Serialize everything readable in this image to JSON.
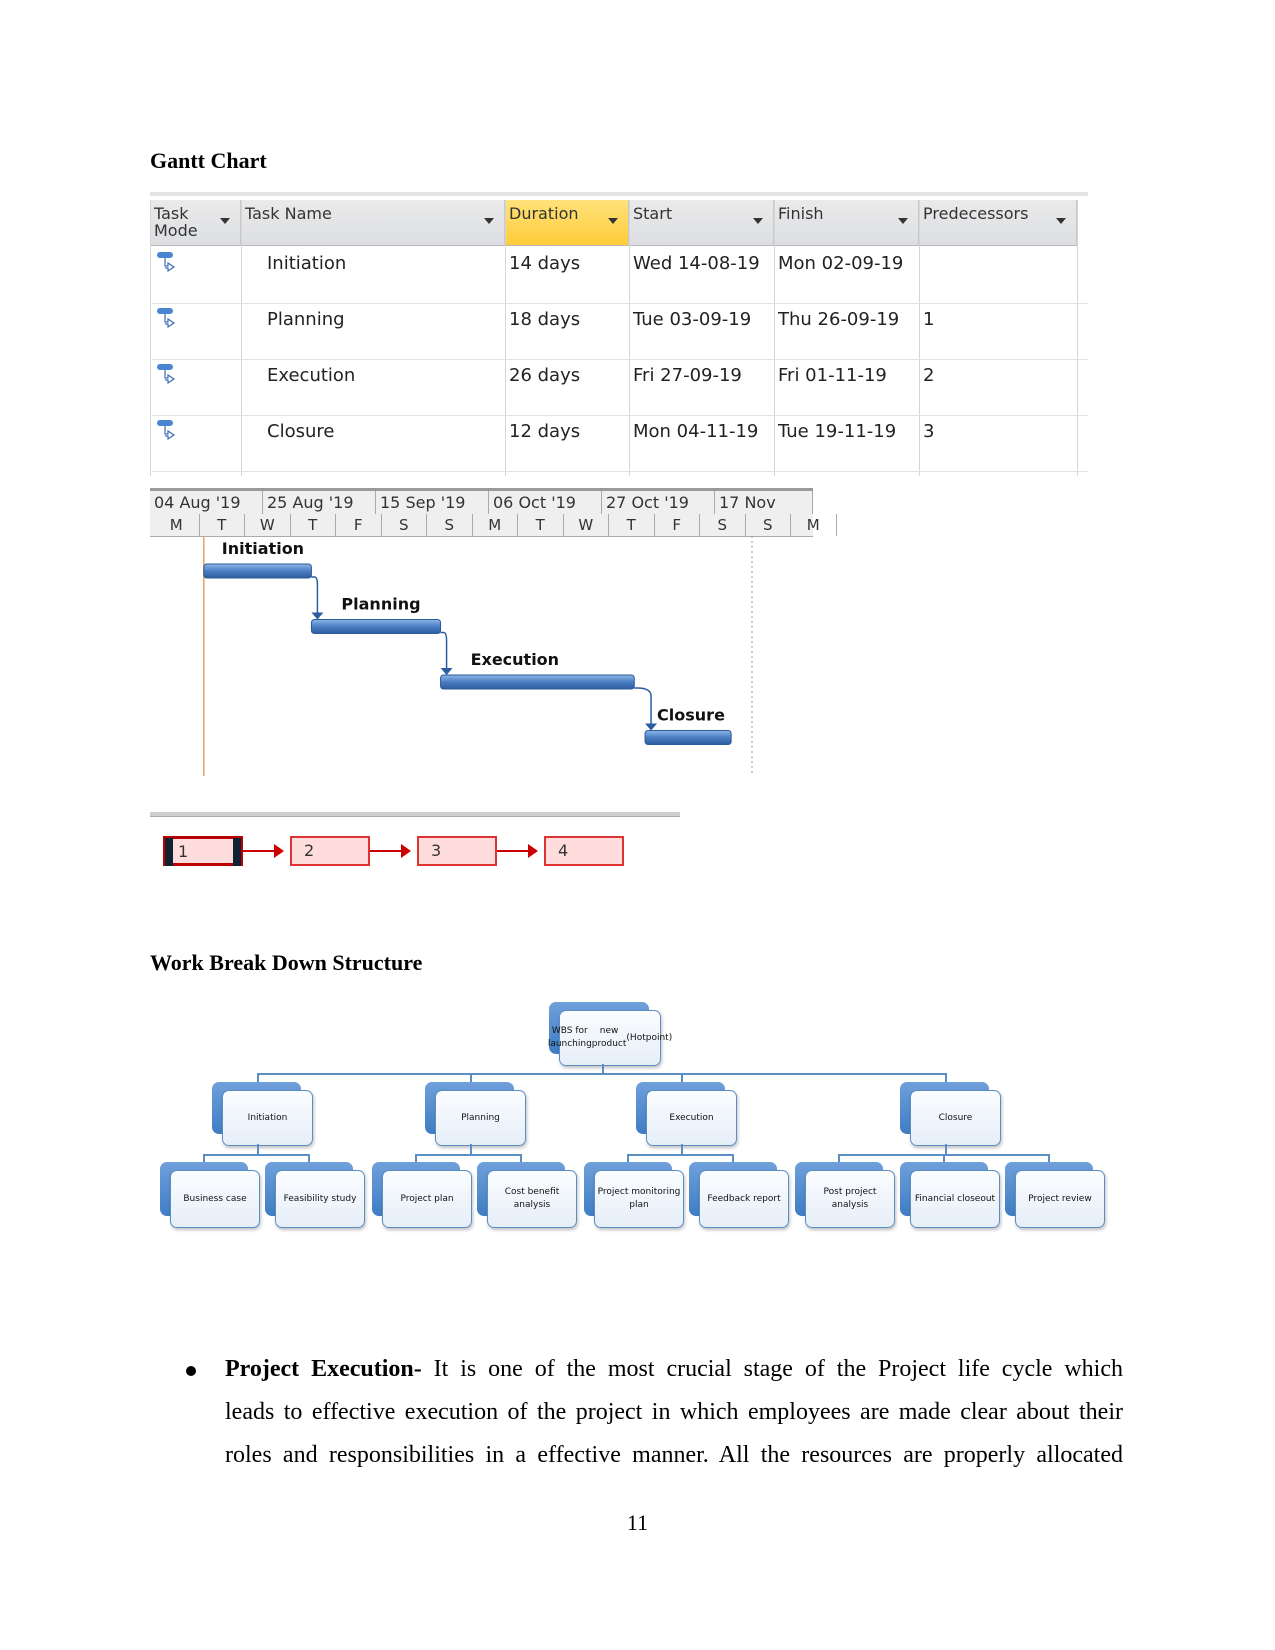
{
  "sections": {
    "gantt_heading": "Gantt Chart",
    "wbs_heading": "Work Break Down Structure"
  },
  "gantt_table": {
    "columns": [
      {
        "label": "Task Mode",
        "highlighted": false
      },
      {
        "label": "Task Name",
        "highlighted": false
      },
      {
        "label": "Duration",
        "highlighted": true
      },
      {
        "label": "Start",
        "highlighted": false
      },
      {
        "label": "Finish",
        "highlighted": false
      },
      {
        "label": "Predecessors",
        "highlighted": false
      }
    ],
    "col_mode_line1": "Task",
    "col_mode_line2": "Mode",
    "rows": [
      {
        "mode_icon": "auto-scheduled-task-icon",
        "name": "Initiation",
        "duration": "14 days",
        "start": "Wed 14-08-19",
        "finish": "Mon 02-09-19",
        "predecessors": ""
      },
      {
        "mode_icon": "auto-scheduled-task-icon",
        "name": "Planning",
        "duration": "18 days",
        "start": "Tue 03-09-19",
        "finish": "Thu 26-09-19",
        "predecessors": "1"
      },
      {
        "mode_icon": "auto-scheduled-task-icon",
        "name": "Execution",
        "duration": "26 days",
        "start": "Fri 27-09-19",
        "finish": "Fri 01-11-19",
        "predecessors": "2"
      },
      {
        "mode_icon": "auto-scheduled-task-icon",
        "name": "Closure",
        "duration": "12 days",
        "start": "Mon 04-11-19",
        "finish": "Tue 19-11-19",
        "predecessors": "3"
      }
    ],
    "header_highlight_color": "#ffd24d"
  },
  "chart_data": {
    "type": "gantt",
    "title": "Gantt Chart",
    "timescale_major": [
      "04 Aug '19",
      "25 Aug '19",
      "15 Sep '19",
      "06 Oct '19",
      "27 Oct '19",
      "17 Nov"
    ],
    "timescale_minor": [
      "M",
      "T",
      "W",
      "T",
      "F",
      "S",
      "S",
      "M",
      "T",
      "W",
      "T",
      "F",
      "S",
      "S",
      "M"
    ],
    "major_unit_days": 21,
    "axis_start": "2019-08-04",
    "axis_end": "2019-11-20",
    "tasks": [
      {
        "name": "Initiation",
        "start": "2019-08-14",
        "finish": "2019-09-02",
        "duration_days": 14,
        "predecessor": null
      },
      {
        "name": "Planning",
        "start": "2019-09-03",
        "finish": "2019-09-26",
        "duration_days": 18,
        "predecessor": "Initiation"
      },
      {
        "name": "Execution",
        "start": "2019-09-27",
        "finish": "2019-11-01",
        "duration_days": 26,
        "predecessor": "Planning"
      },
      {
        "name": "Closure",
        "start": "2019-11-04",
        "finish": "2019-11-19",
        "duration_days": 12,
        "predecessor": "Execution"
      }
    ],
    "project_start_line": "2019-08-14",
    "bar_color": "#4a7ec2",
    "link_color": "#2a5da0",
    "start_line_color": "#e8a060"
  },
  "network": {
    "nodes": [
      "1",
      "2",
      "3",
      "4"
    ],
    "selected": "1",
    "box_fill": "#ffdede",
    "box_border": "#d32f2f",
    "arrow_color": "#c00000"
  },
  "wbs": {
    "root": {
      "label_lines": [
        "WBS for launching",
        "new product",
        "(Hotpoint)"
      ]
    },
    "phases": [
      {
        "label": "Initiation",
        "children": [
          "Business case",
          "Feasibility study"
        ]
      },
      {
        "label": "Planning",
        "children": [
          "Project plan",
          "Cost benefit analysis"
        ]
      },
      {
        "label": "Execution",
        "children": [
          "Project monitoring plan",
          "Feedback report"
        ]
      },
      {
        "label": "Closure",
        "children": [
          "Post project analysis",
          "Financial closeout",
          "Project review"
        ]
      }
    ],
    "accent_color": "#4a86cf"
  },
  "body": {
    "bullet_bold": "Project Execution-",
    "lines": [
      " It is one of the most crucial stage of the Project life cycle which",
      "leads to effective execution of the project in which employees are made clear about their",
      "roles and responsibilities in a effective manner. All the resources are properly allocated"
    ]
  },
  "page_number": "11"
}
